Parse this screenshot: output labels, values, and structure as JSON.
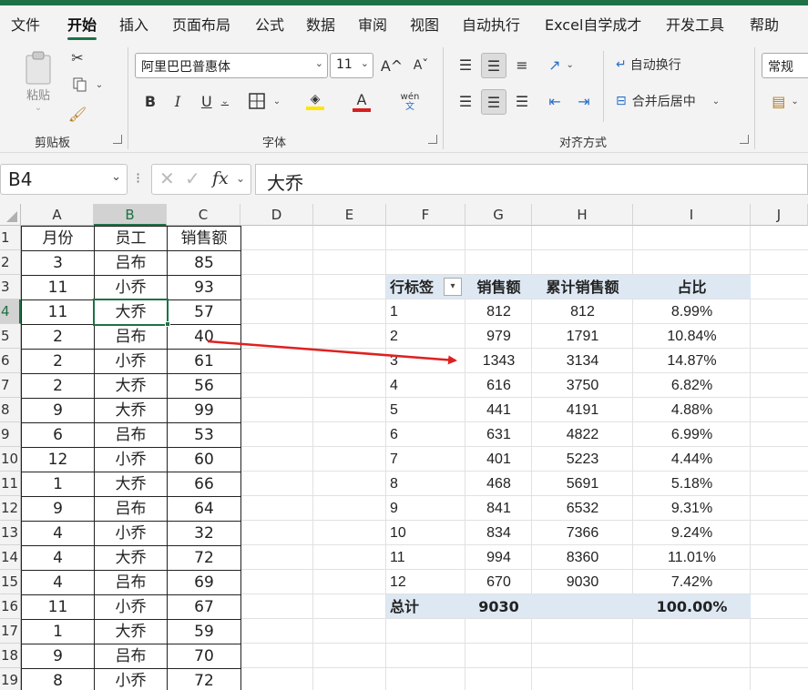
{
  "ribbon": {
    "tabs": [
      "文件",
      "开始",
      "插入",
      "页面布局",
      "公式",
      "数据",
      "审阅",
      "视图",
      "自动执行",
      "Excel自学成才",
      "开发工具",
      "帮助"
    ],
    "active_tab": "开始",
    "clipboard": {
      "paste_label": "粘贴",
      "group_label": "剪贴板"
    },
    "font": {
      "name": "阿里巴巴普惠体",
      "size": "11",
      "group_label": "字体",
      "bold": "B",
      "italic": "I",
      "underline": "U",
      "grow": "A^",
      "shrink": "Aˇ",
      "font_color_letter": "A",
      "phonetic_top": "wén",
      "phonetic_bottom": "文"
    },
    "alignment": {
      "wrap_text": "自动换行",
      "merge_center": "合并后居中",
      "group_label": "对齐方式"
    },
    "number": {
      "format": "常规"
    }
  },
  "formula_bar": {
    "name_box": "B4",
    "fx": "fx",
    "content": "大乔"
  },
  "columns": [
    "A",
    "B",
    "C",
    "D",
    "E",
    "F",
    "G",
    "H",
    "I",
    "J"
  ],
  "rows": [
    "1",
    "2",
    "3",
    "4",
    "5",
    "6",
    "7",
    "8",
    "9",
    "10",
    "11",
    "12",
    "13",
    "14",
    "15",
    "16",
    "17",
    "18",
    "19"
  ],
  "source_table": {
    "headers": [
      "月份",
      "员工",
      "销售额"
    ],
    "rows": [
      [
        "3",
        "吕布",
        "85"
      ],
      [
        "11",
        "小乔",
        "93"
      ],
      [
        "11",
        "大乔",
        "57"
      ],
      [
        "2",
        "吕布",
        "40"
      ],
      [
        "2",
        "小乔",
        "61"
      ],
      [
        "2",
        "大乔",
        "56"
      ],
      [
        "9",
        "大乔",
        "99"
      ],
      [
        "6",
        "吕布",
        "53"
      ],
      [
        "12",
        "小乔",
        "60"
      ],
      [
        "1",
        "大乔",
        "66"
      ],
      [
        "9",
        "吕布",
        "64"
      ],
      [
        "4",
        "小乔",
        "32"
      ],
      [
        "4",
        "大乔",
        "72"
      ],
      [
        "4",
        "吕布",
        "69"
      ],
      [
        "11",
        "小乔",
        "67"
      ],
      [
        "1",
        "大乔",
        "59"
      ],
      [
        "9",
        "吕布",
        "70"
      ],
      [
        "8",
        "小乔",
        "72"
      ]
    ]
  },
  "pivot": {
    "headers": [
      "行标签",
      "销售额",
      "累计销售额",
      "占比"
    ],
    "rows": [
      [
        "1",
        "812",
        "812",
        "8.99%"
      ],
      [
        "2",
        "979",
        "1791",
        "10.84%"
      ],
      [
        "3",
        "1343",
        "3134",
        "14.87%"
      ],
      [
        "4",
        "616",
        "3750",
        "6.82%"
      ],
      [
        "5",
        "441",
        "4191",
        "4.88%"
      ],
      [
        "6",
        "631",
        "4822",
        "6.99%"
      ],
      [
        "7",
        "401",
        "5223",
        "4.44%"
      ],
      [
        "8",
        "468",
        "5691",
        "5.18%"
      ],
      [
        "9",
        "841",
        "6532",
        "9.31%"
      ],
      [
        "10",
        "834",
        "7366",
        "9.24%"
      ],
      [
        "11",
        "994",
        "8360",
        "11.01%"
      ],
      [
        "12",
        "670",
        "9030",
        "7.42%"
      ]
    ],
    "total": [
      "总计",
      "9030",
      "",
      "100.00%"
    ]
  },
  "colors": {
    "accent_green": "#1e7145",
    "arrow_red": "#e02020",
    "pivot_band": "#dde8f3"
  }
}
